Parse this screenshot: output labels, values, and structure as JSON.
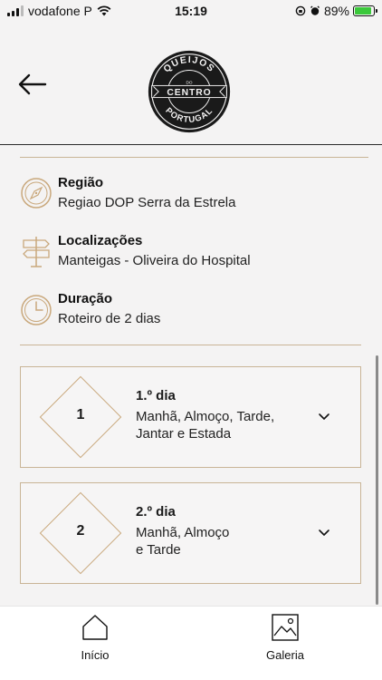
{
  "status_bar": {
    "carrier": "vodafone P",
    "time": "15:19",
    "battery": "89%",
    "battery_level": 0.89
  },
  "header": {
    "logo_text_top": "QUEIJOS",
    "logo_text_middle": "CENTRO",
    "logo_text_small": "DO",
    "logo_text_bottom": "PORTUGAL"
  },
  "info": {
    "region": {
      "title": "Região",
      "value": "Regiao DOP Serra da Estrela",
      "icon": "compass-icon"
    },
    "locations": {
      "title": "Localizações",
      "value": "Manteigas - Oliveira do Hospital",
      "icon": "signpost-icon"
    },
    "duration": {
      "title": "Duração",
      "value": "Roteiro de 2 dias",
      "icon": "clock-icon"
    }
  },
  "days": [
    {
      "number": "1",
      "title": "1.º dia",
      "line1": "Manhã, Almoço, Tarde,",
      "line2": "Jantar e Estada"
    },
    {
      "number": "2",
      "title": "2.º dia",
      "line1": "Manhã, Almoço",
      "line2": "e Tarde"
    }
  ],
  "nav": {
    "home": {
      "label": "Início",
      "icon": "home-icon"
    },
    "gallery": {
      "label": "Galeria",
      "icon": "image-icon"
    }
  },
  "colors": {
    "accent": "#c9a87c",
    "divider": "#c9b496",
    "background": "#f4f3f3"
  }
}
